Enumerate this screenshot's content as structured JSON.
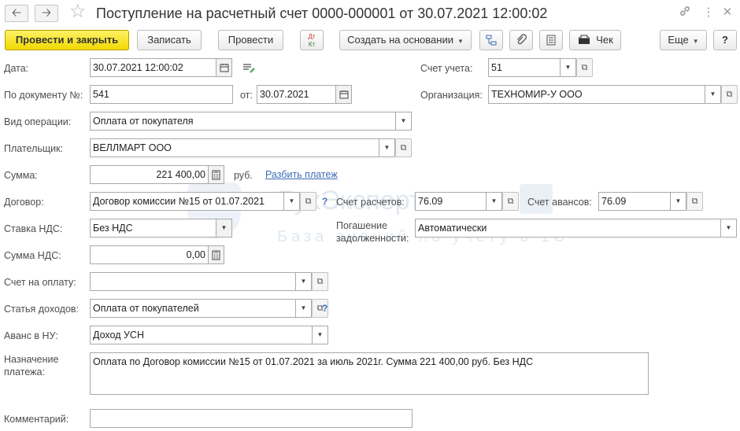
{
  "title": "Поступление на расчетный счет 0000-000001 от 30.07.2021 12:00:02",
  "nav": {
    "back_icon": "arrow-left-icon",
    "forward_icon": "arrow-right-icon",
    "favorite_icon": "star-icon",
    "link_icon": "link-icon",
    "menu_icon": "more-vertical-icon",
    "close_icon": "close-icon"
  },
  "toolbar": {
    "post_and_close": "Провести и закрыть",
    "save": "Записать",
    "post": "Провести",
    "dt_kt": "Дт",
    "dt_kt_sub": "Кт",
    "create_based_on": "Создать на основании",
    "receipt": "Чек",
    "more": "Еще",
    "help": "?"
  },
  "form": {
    "date": {
      "label": "Дата:",
      "value": "30.07.2021 12:00:02"
    },
    "doc_number": {
      "label": "По документу №:",
      "value": "541"
    },
    "doc_date": {
      "label": "от:",
      "value": "30.07.2021"
    },
    "account": {
      "label": "Счет учета:",
      "value": "51"
    },
    "organization": {
      "label": "Организация:",
      "value": "ТЕХНОМИР-У ООО"
    },
    "operation_type": {
      "label": "Вид операции:",
      "value": "Оплата от покупателя"
    },
    "payer": {
      "label": "Плательщик:",
      "value": "ВЕЛЛМАРТ ООО"
    },
    "amount": {
      "label": "Сумма:",
      "value": "221 400,00",
      "currency": "руб.",
      "split_link": "Разбить платеж"
    },
    "contract": {
      "label": "Договор:",
      "value": "Договор комиссии №15 от 01.07.2021",
      "help": "?"
    },
    "settlement_account": {
      "label": "Счет расчетов:",
      "value": "76.09"
    },
    "advance_account": {
      "label": "Счет авансов:",
      "value": "76.09"
    },
    "vat_rate": {
      "label": "Ставка НДС:",
      "value": "Без НДС"
    },
    "debt_repayment": {
      "label_line1": "Погашение",
      "label_line2": "задолженности:",
      "value": "Автоматически"
    },
    "vat_amount": {
      "label": "Сумма НДС:",
      "value": "0,00"
    },
    "invoice": {
      "label": "Счет на оплату:",
      "value": ""
    },
    "income_item": {
      "label": "Статья доходов:",
      "value": "Оплата от покупателей",
      "help": "?"
    },
    "advance_tax": {
      "label": "Аванс в НУ:",
      "value": "Доход УСН"
    },
    "payment_purpose": {
      "label_line1": "Назначение",
      "label_line2": "платежа:",
      "value": "Оплата по Договор комиссии №15 от 01.07.2021 за июль 2021г. Сумма 221 400,00 руб. Без НДС"
    },
    "comment": {
      "label": "Комментарий:",
      "value": ""
    }
  },
  "watermark": {
    "line1": "БухЭксперт",
    "line2": "База знаний по учету в 1С"
  },
  "colors": {
    "primary_button": "#f5de00",
    "link": "#3d6bb5",
    "border": "#a9a9a9"
  }
}
